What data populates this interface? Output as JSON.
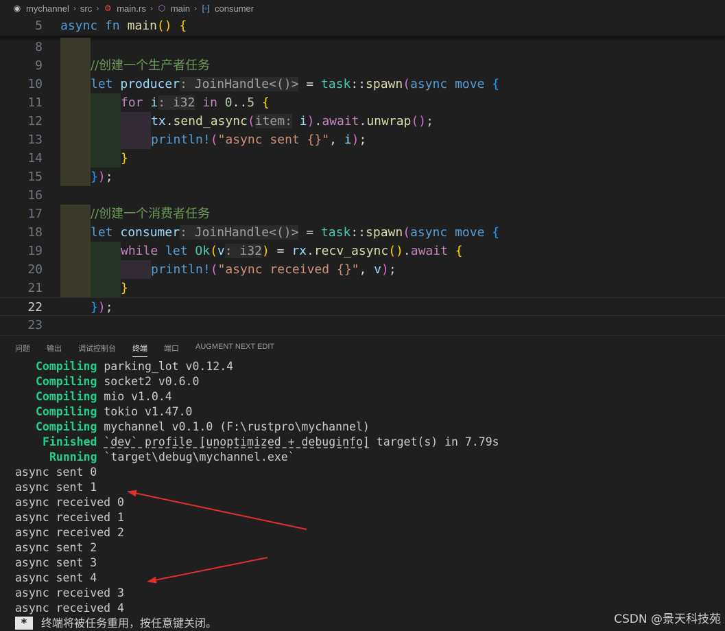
{
  "breadcrumb": {
    "items": [
      {
        "label": "mychannel",
        "icon": "git-repo-icon"
      },
      {
        "label": "src",
        "icon": ""
      },
      {
        "label": "main.rs",
        "icon": "rust-icon"
      },
      {
        "label": "main",
        "icon": "cube-icon"
      },
      {
        "label": "consumer",
        "icon": "variable-icon"
      }
    ]
  },
  "editor": {
    "line_numbers": [
      "5",
      "8",
      "9",
      "10",
      "11",
      "12",
      "13",
      "14",
      "15",
      "16",
      "17",
      "18",
      "19",
      "20",
      "21",
      "22",
      "23"
    ],
    "current_line": "22",
    "tokens": {
      "async": "async",
      "fn": "fn",
      "main": "main",
      "paren_open": "(",
      "paren_close": ")",
      "brace_open": "{",
      "brace_close": "}",
      "comment1": "//创建一个生产者任务",
      "comment2": "//创建一个消费者任务",
      "let": "let",
      "producer": "producer",
      "consumer": "consumer",
      "hint_join": ": JoinHandle<()>",
      "eq": " = ",
      "task": "task",
      "sep": "::",
      "spawn": "spawn",
      "move": "move",
      "for": "for",
      "i": "i",
      "hint_i32": ": i32",
      "in": "in",
      "zero": "0",
      "range": "..",
      "five": "5",
      "tx": "tx",
      "dot": ".",
      "send_async": "send_async",
      "hint_item": "item:",
      "await": "await",
      "unwrap": "unwrap",
      "println": "println!",
      "str_sent": "\"async sent {}\"",
      "comma": ", ",
      "semi": ";",
      "close_stmt": ");",
      "while": "while",
      "Ok": "Ok",
      "v": "v",
      "hint_v": ": i32",
      "rx": "rx",
      "recv_async": "recv_async",
      "str_received": "\"async received {}\""
    }
  },
  "panel": {
    "tabs": [
      "问题",
      "输出",
      "调试控制台",
      "终端",
      "端口",
      "AUGMENT NEXT EDIT"
    ],
    "active_tab": "终端"
  },
  "terminal": {
    "compiling": [
      {
        "status": "Compiling",
        "text": "parking_lot v0.12.4"
      },
      {
        "status": "Compiling",
        "text": "socket2 v0.6.0"
      },
      {
        "status": "Compiling",
        "text": "mio v1.0.4"
      },
      {
        "status": "Compiling",
        "text": "tokio v1.47.0"
      },
      {
        "status": "Compiling",
        "text": "mychannel v0.1.0 (F:\\rustpro\\mychannel)"
      }
    ],
    "finished_status": "Finished",
    "finished_pre": "",
    "finished_link": "`dev` profile [unoptimized + debuginfo]",
    "finished_post": " target(s) in 7.79s",
    "running_status": "Running",
    "running_text": "`target\\debug\\mychannel.exe`",
    "output": [
      "async sent 0",
      "async sent 1",
      "async received 0",
      "async received 1",
      "async received 2",
      "async sent 2",
      "async sent 3",
      "async sent 4",
      "async received 3",
      "async received 4"
    ],
    "reuse_badge": "*",
    "reuse_text": "终端将被任务重用，按任意键关闭。"
  },
  "annotation": {
    "arrow_color": "#e0302a"
  },
  "watermark": "CSDN @景天科技苑"
}
